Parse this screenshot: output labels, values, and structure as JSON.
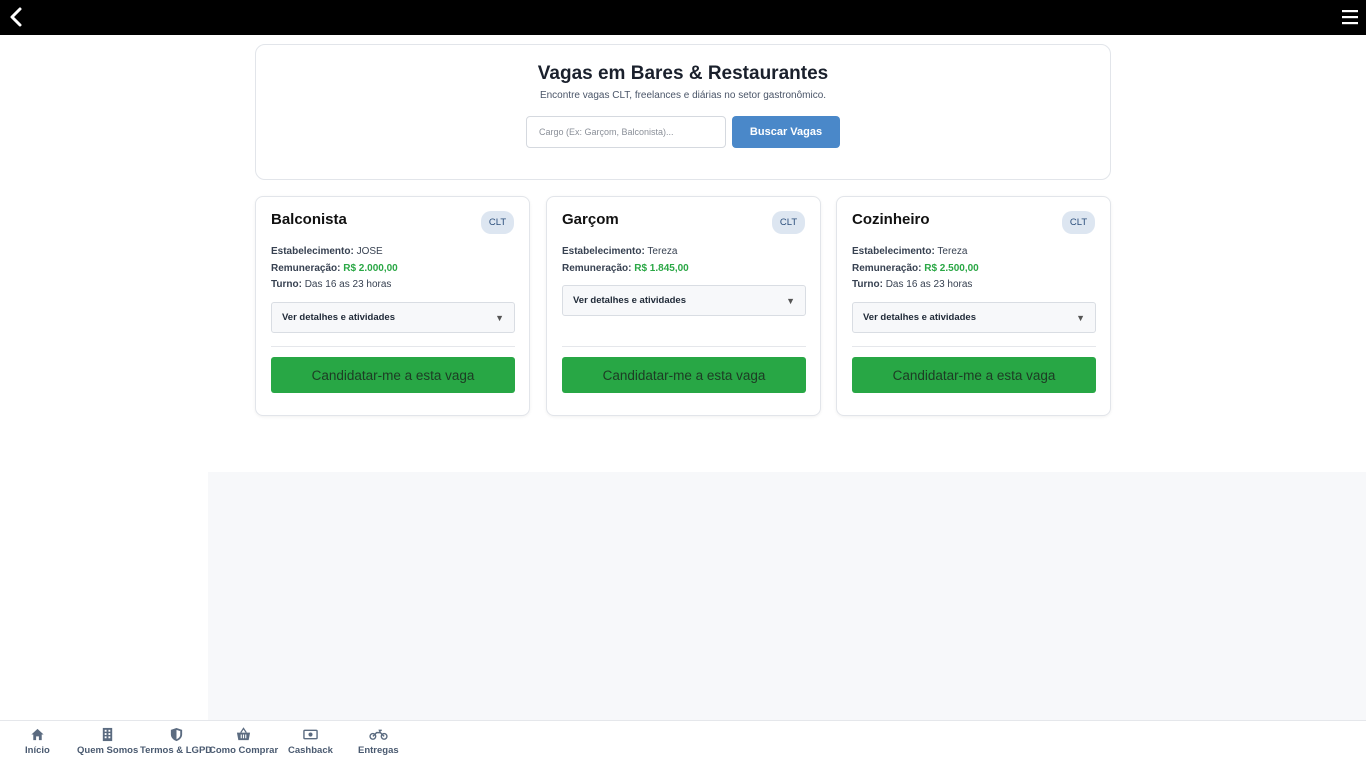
{
  "header": {
    "back_icon": "chevron-left-icon",
    "menu_icon": "hamburger-menu-icon"
  },
  "search": {
    "title": "Vagas em Bares & Restaurantes",
    "subtitle": "Encontre vagas CLT, freelances e diárias no setor gastronômico.",
    "placeholder": "Cargo (Ex: Garçom, Balconista)...",
    "button_label": "Buscar Vagas"
  },
  "labels": {
    "establishment": "Estabelecimento:",
    "salary": "Remuneração:",
    "shift": "Turno:",
    "details": "Ver detalhes e atividades",
    "apply": "Candidatar-me a esta vaga"
  },
  "jobs": [
    {
      "title": "Balconista",
      "badge": "CLT",
      "establishment": "JOSE",
      "salary": "R$ 2.000,00",
      "shift": "Das 16 as 23 horas"
    },
    {
      "title": "Garçom",
      "badge": "CLT",
      "establishment": "Tereza",
      "salary": "R$ 1.845,00",
      "shift": ""
    },
    {
      "title": "Cozinheiro",
      "badge": "CLT",
      "establishment": "Tereza",
      "salary": "R$ 2.500,00",
      "shift": "Das 16 as 23 horas"
    }
  ],
  "colors": {
    "topbar": "#000000",
    "search_button": "#4a88c9",
    "apply_button": "#28a745",
    "salary_text": "#2aa745"
  },
  "bottom_nav": [
    {
      "label": "Início",
      "icon": "home-icon"
    },
    {
      "label": "Quem Somos",
      "icon": "building-icon"
    },
    {
      "label": "Termos & LGPD",
      "icon": "shield-icon"
    },
    {
      "label": "Como Comprar",
      "icon": "basket-icon"
    },
    {
      "label": "Cashback",
      "icon": "money-bill-icon"
    },
    {
      "label": "Entregas",
      "icon": "motorcycle-icon"
    }
  ]
}
